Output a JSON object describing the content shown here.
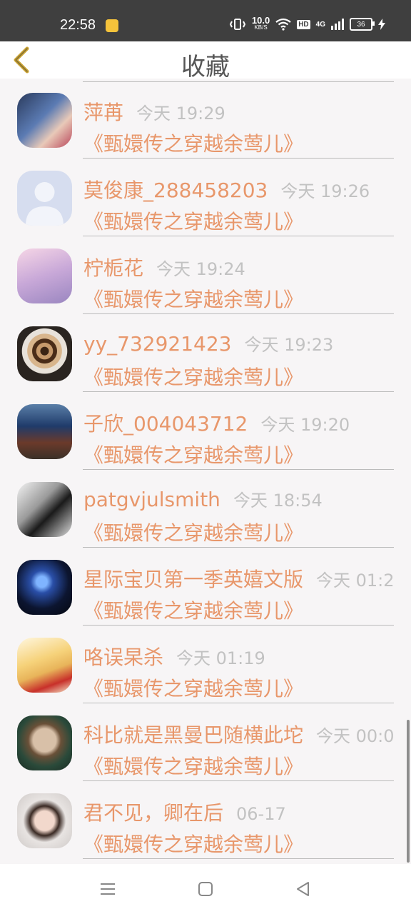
{
  "status_bar": {
    "time": "22:58",
    "speed_value": "10.0",
    "speed_unit": "KB/S",
    "hd": "HD",
    "network": "4G",
    "battery": "36"
  },
  "header": {
    "title": "收藏"
  },
  "items": [
    {
      "name": "萍苒",
      "time": "今天 19:29",
      "book": "《甄嬛传之穿越余莺儿》"
    },
    {
      "name": "莫俊康_288458203",
      "time": "今天 19:26",
      "book": "《甄嬛传之穿越余莺儿》"
    },
    {
      "name": "柠栀花",
      "time": "今天 19:24",
      "book": "《甄嬛传之穿越余莺儿》"
    },
    {
      "name": "yy_732921423",
      "time": "今天 19:23",
      "book": "《甄嬛传之穿越余莺儿》"
    },
    {
      "name": "子欣_004043712",
      "time": "今天 19:20",
      "book": "《甄嬛传之穿越余莺儿》"
    },
    {
      "name": "patgvjulsmith",
      "time": "今天 18:54",
      "book": "《甄嬛传之穿越余莺儿》"
    },
    {
      "name": "星际宝贝第一季英嬉文版",
      "time": "今天 01:2",
      "book": "《甄嬛传之穿越余莺儿》"
    },
    {
      "name": "咯误杲杀",
      "time": "今天 01:19",
      "book": "《甄嬛传之穿越余莺儿》"
    },
    {
      "name": "科比就是黑曼巴随横此坨",
      "time": "今天 00:0",
      "book": "《甄嬛传之穿越余莺儿》"
    },
    {
      "name": "君不见，卿在后",
      "time": "06-17",
      "book": "《甄嬛传之穿越余莺儿》"
    }
  ],
  "colors": {
    "accent": "#e8976b",
    "time_gray": "#c2c2c2",
    "back_arrow": "#c9a233"
  },
  "icons": [
    "back-arrow-icon",
    "menu-icon",
    "home-icon",
    "back-triangle-icon"
  ]
}
